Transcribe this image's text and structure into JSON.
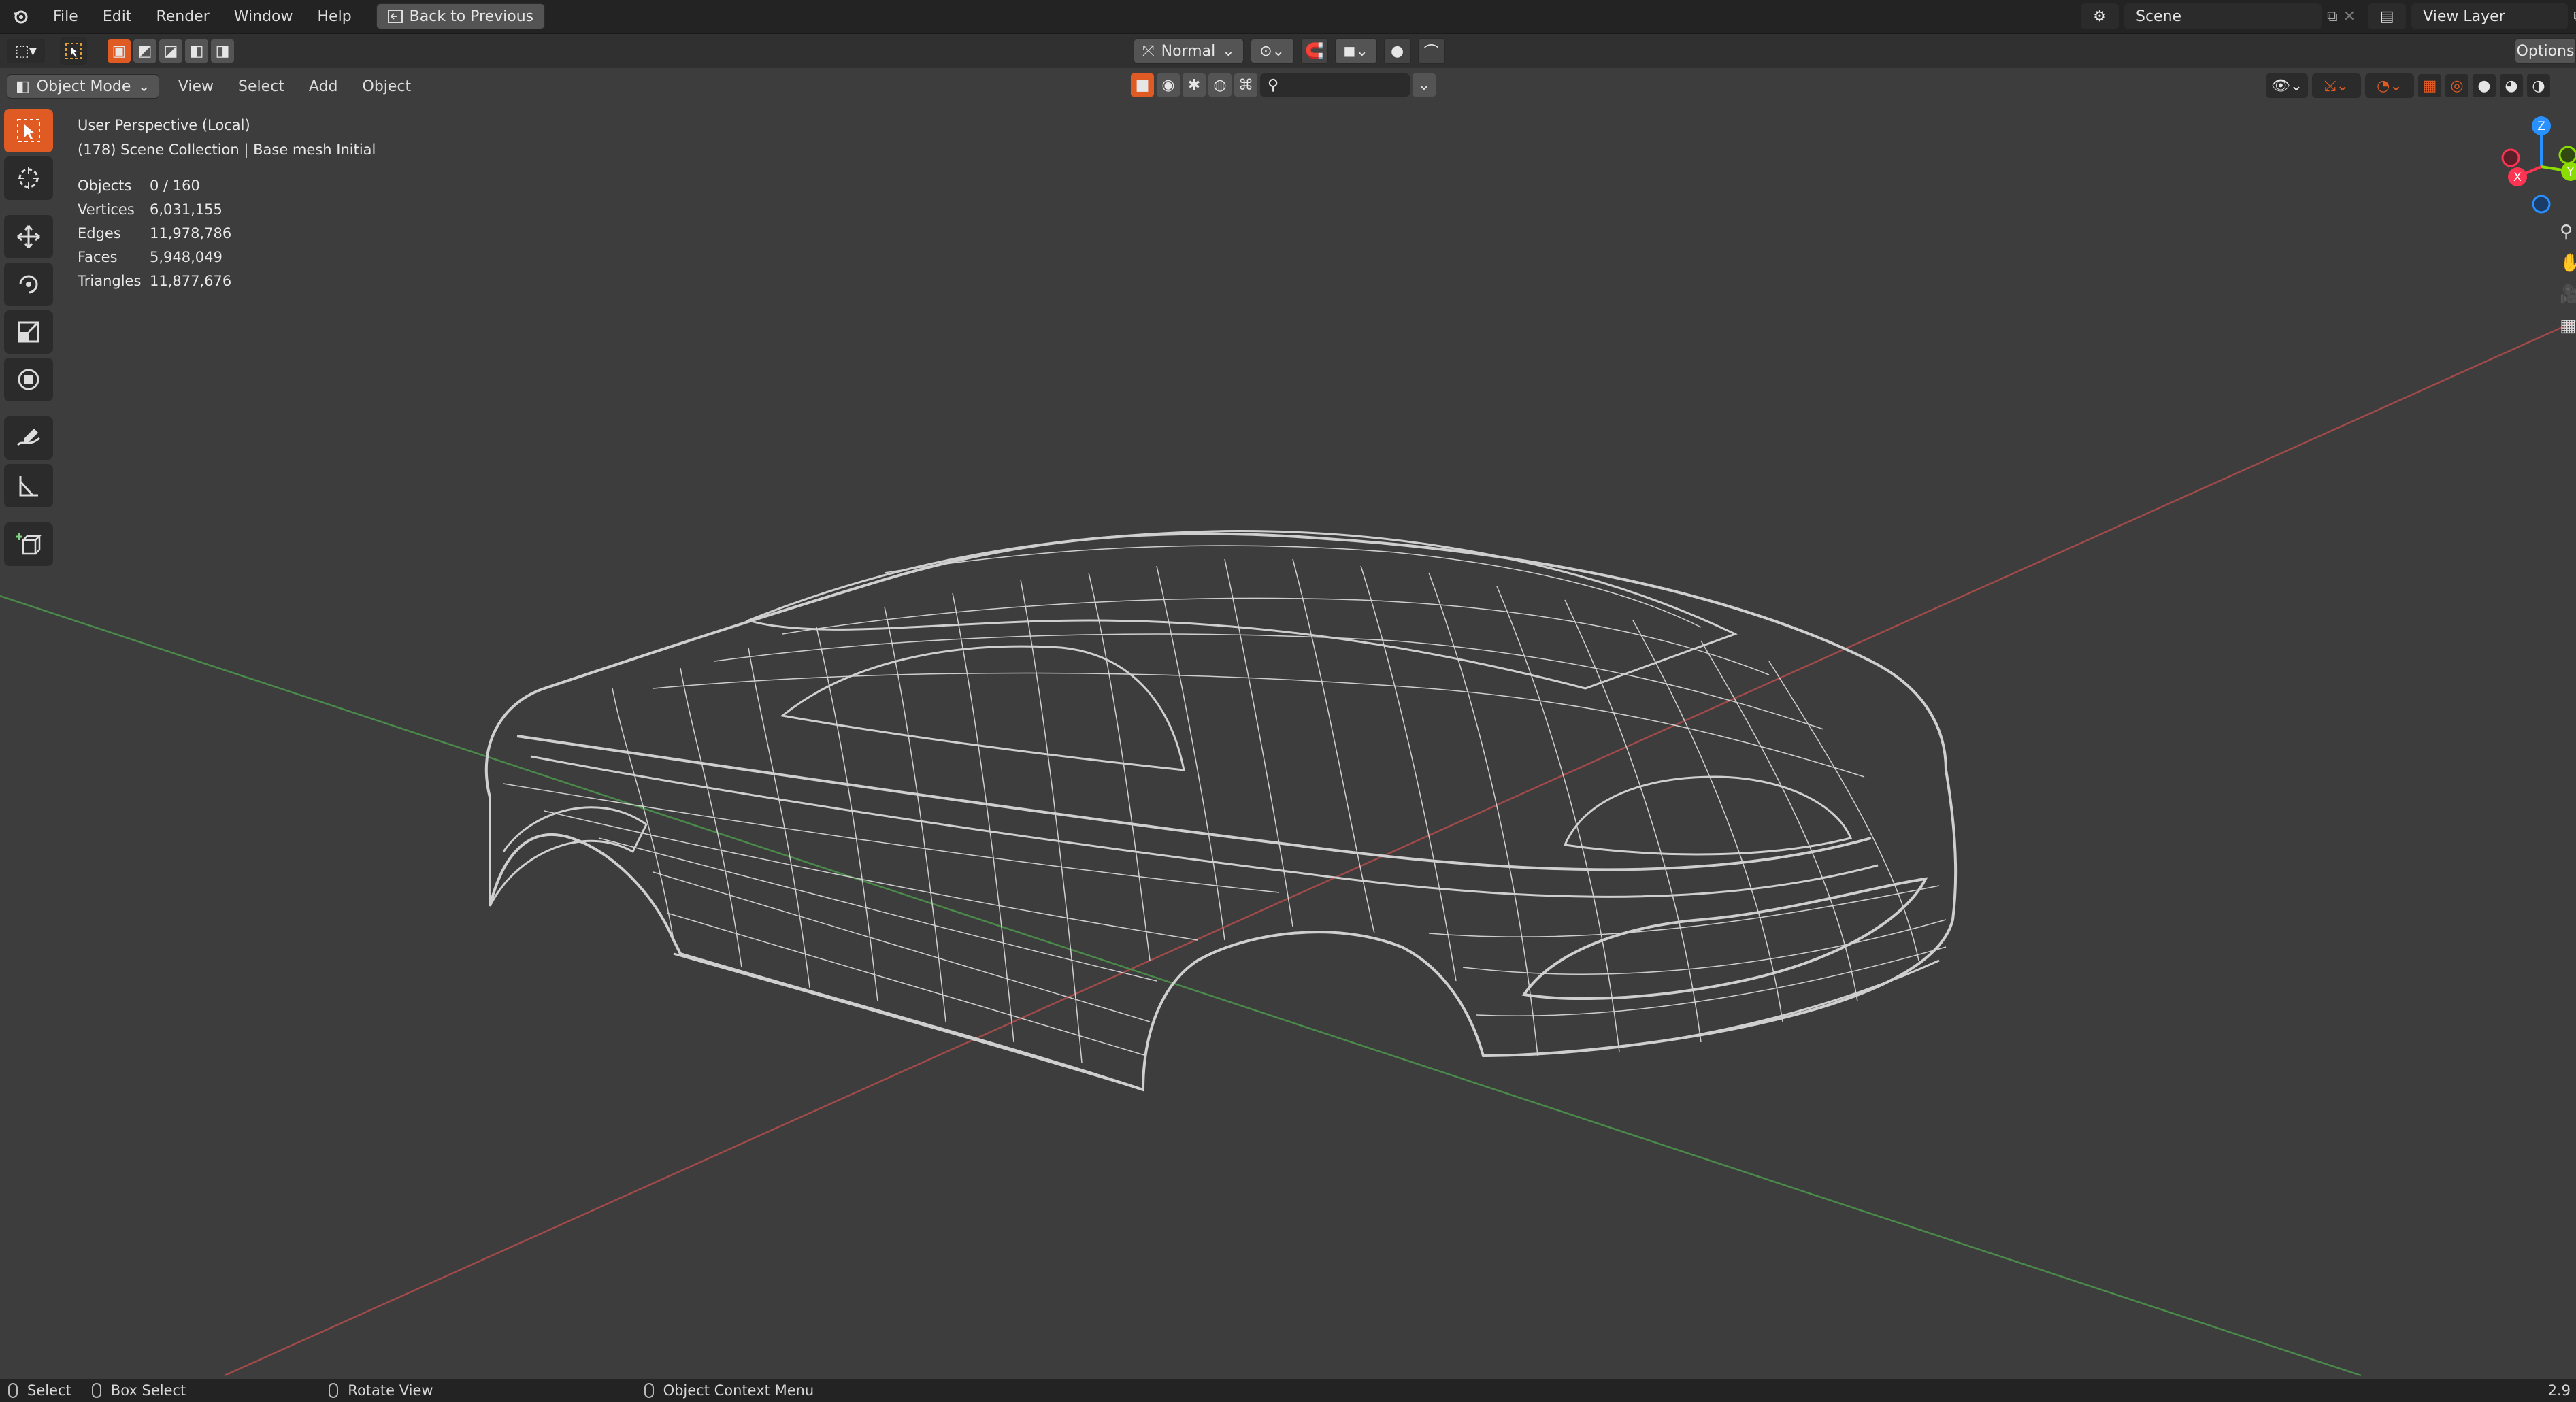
{
  "app": {
    "menu": [
      "File",
      "Edit",
      "Render",
      "Window",
      "Help"
    ],
    "back_button": "Back to Previous",
    "scene_label": "Scene",
    "view_layer_label": "View Layer",
    "options_label": "Options"
  },
  "header": {
    "orientation": "Normal",
    "mode": "Object Mode",
    "view_menu": [
      "View",
      "Select",
      "Add",
      "Object"
    ]
  },
  "viewport": {
    "perspective": "User Perspective (Local)",
    "collection": "(178) Scene Collection | Base mesh Initial",
    "stats": [
      {
        "label": "Objects",
        "value": "0 / 160"
      },
      {
        "label": "Vertices",
        "value": "6,031,155"
      },
      {
        "label": "Edges",
        "value": "11,978,786"
      },
      {
        "label": "Faces",
        "value": "5,948,049"
      },
      {
        "label": "Triangles",
        "value": "11,877,676"
      }
    ],
    "gizmo": {
      "x": "X",
      "y": "Y",
      "z": "Z"
    },
    "colors": {
      "accent": "#e05a24",
      "x_axis": "#ff3352",
      "y_axis": "#8bdc00",
      "z_axis": "#2890ff",
      "wire": "#d0d0d0"
    }
  },
  "status": {
    "select": "Select",
    "box_select": "Box Select",
    "rotate_view": "Rotate View",
    "context_menu": "Object Context Menu",
    "version": "2.9"
  }
}
